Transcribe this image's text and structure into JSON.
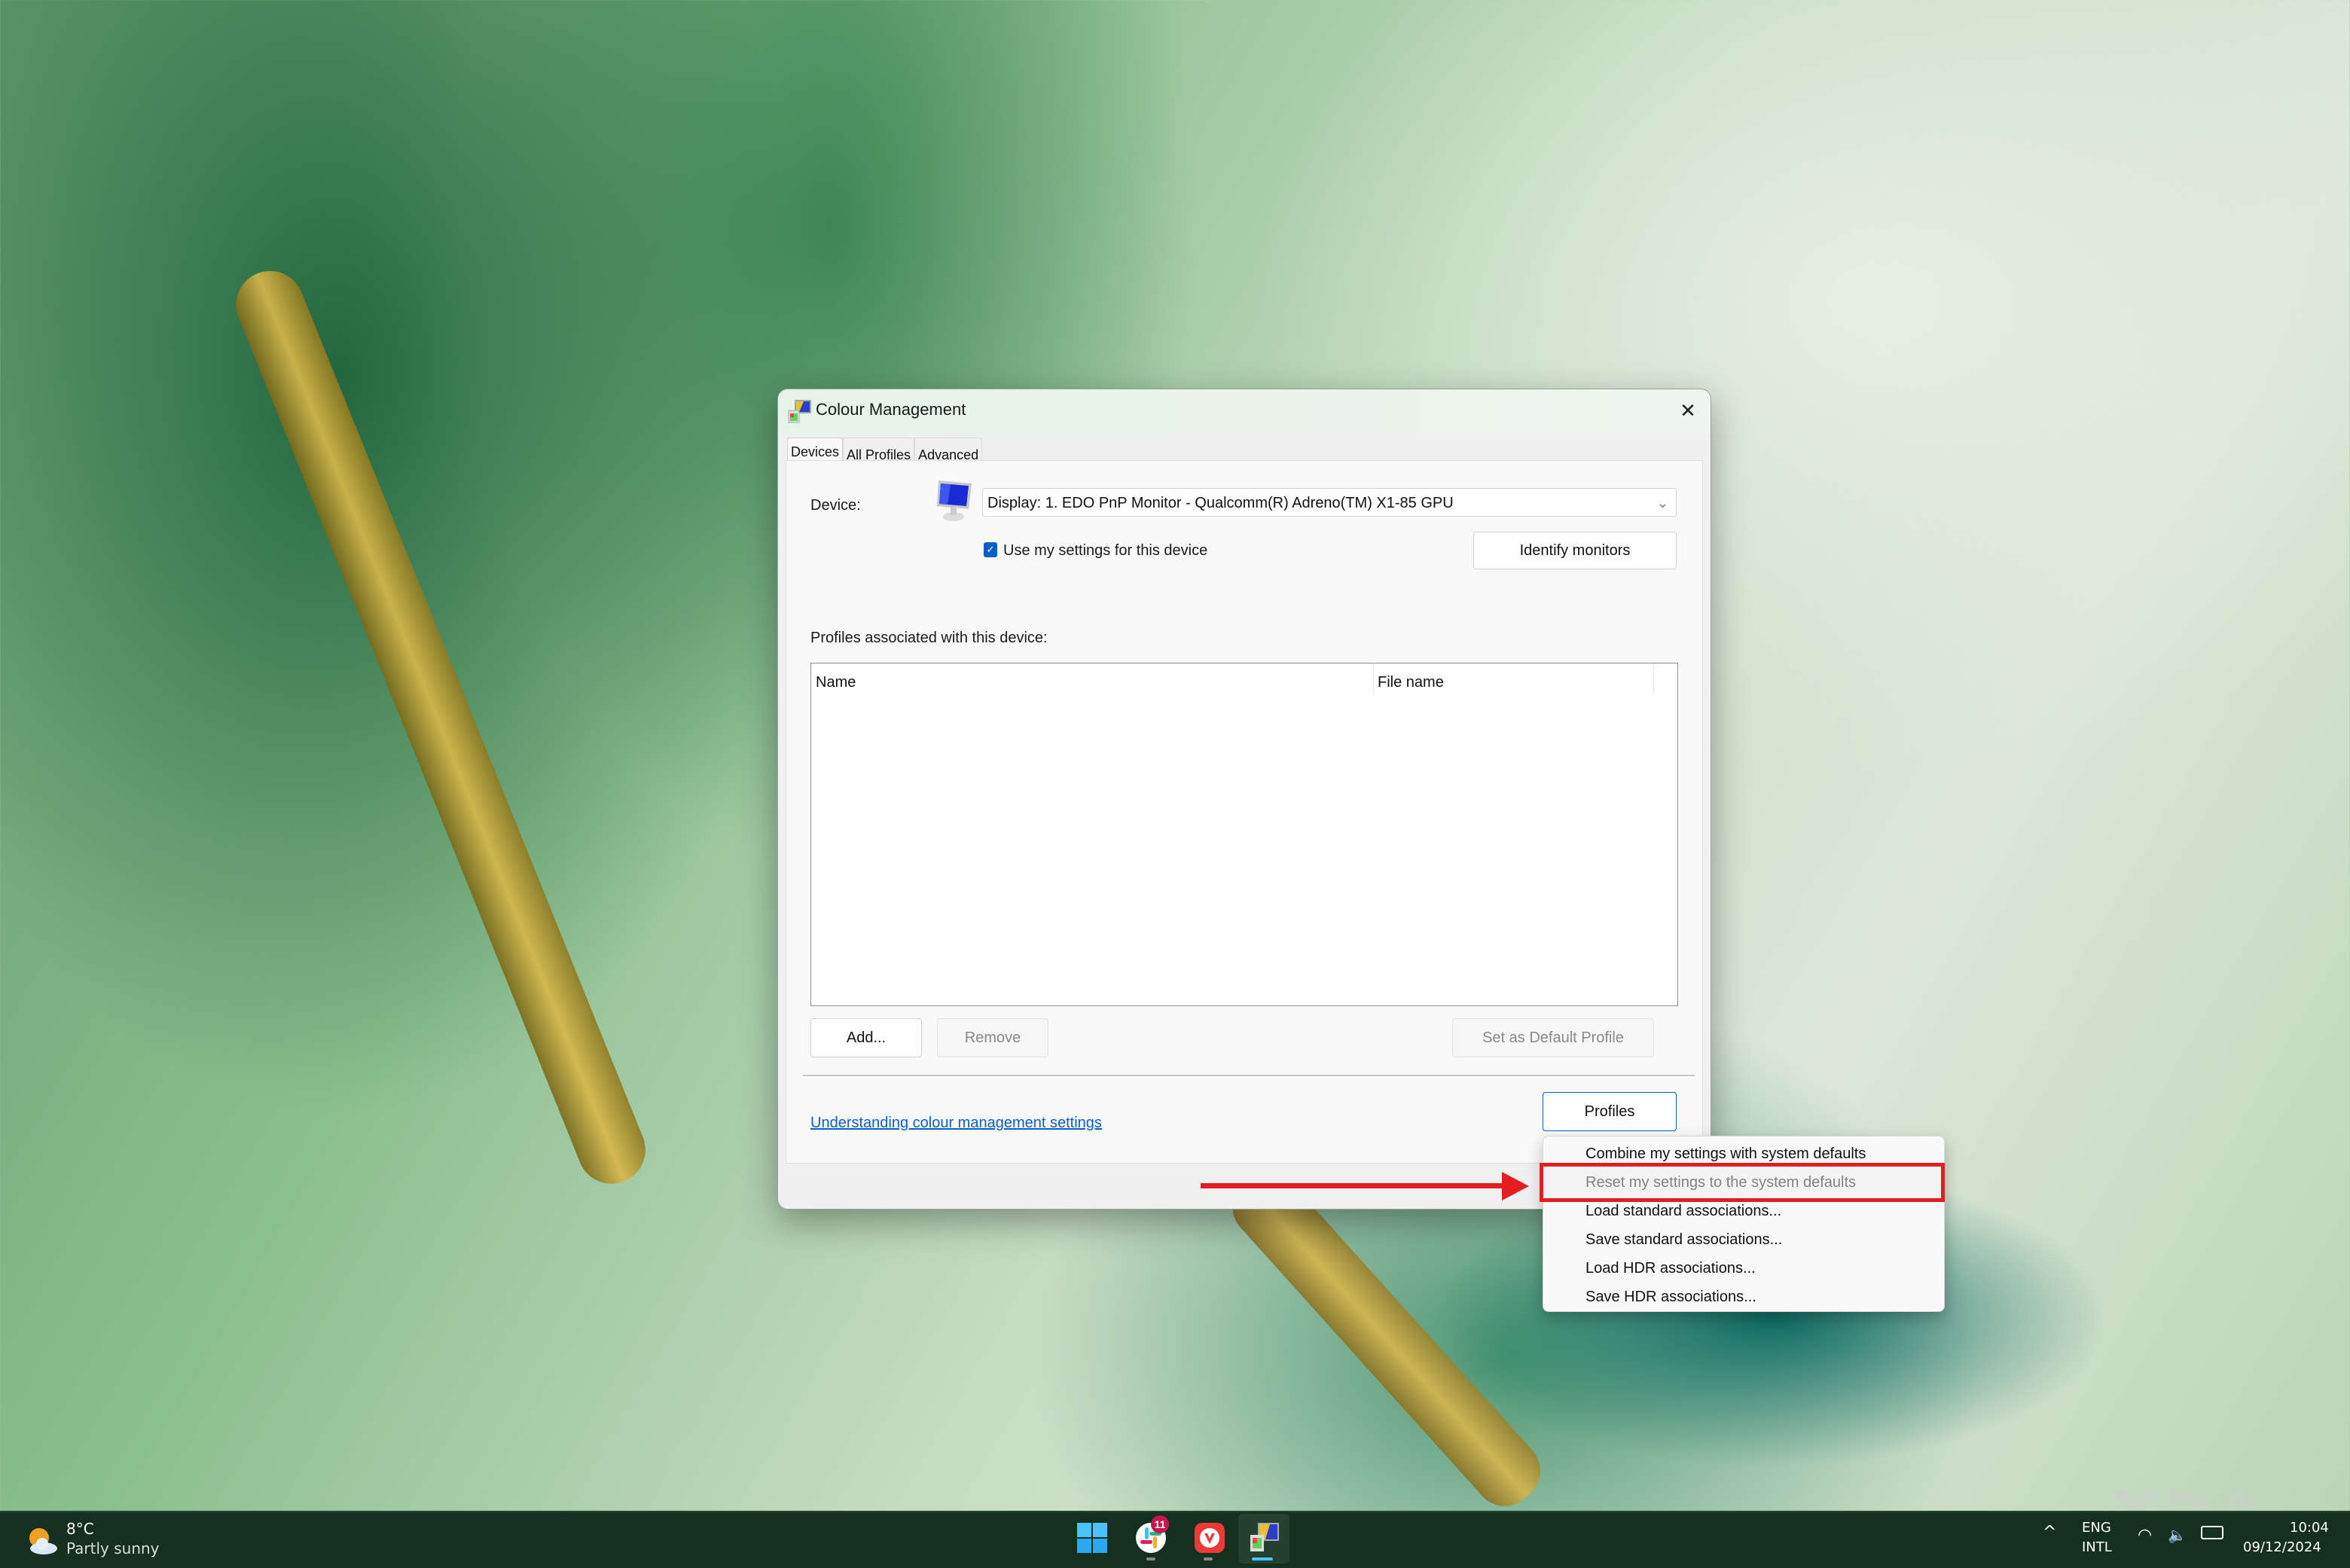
{
  "window": {
    "title": "Colour Management",
    "close_label": "✕",
    "tabs": [
      {
        "label": "Devices",
        "active": true
      },
      {
        "label": "All Profiles",
        "active": false
      },
      {
        "label": "Advanced",
        "active": false
      }
    ],
    "device_label": "Device:",
    "device_value": "Display: 1. EDO PnP Monitor - Qualcomm(R) Adreno(TM) X1-85 GPU",
    "use_my_settings_label": "Use my settings for this device",
    "use_my_settings_checked": true,
    "identify_monitors_label": "Identify monitors",
    "profiles_associated_label": "Profiles associated with this device:",
    "list_columns": [
      "Name",
      "File name"
    ],
    "list_rows": [],
    "add_label": "Add...",
    "remove_label": "Remove",
    "set_default_label": "Set as Default Profile",
    "help_link": "Understanding colour management settings",
    "profiles_button_label": "Profiles"
  },
  "profiles_menu": {
    "items": [
      "Combine my settings with system defaults",
      "Reset my settings to the system defaults",
      "Load standard associations...",
      "Save standard associations...",
      "Load HDR associations...",
      "Save HDR associations..."
    ],
    "highlighted_index": 1
  },
  "annotation": {
    "color": "#e41d23",
    "target": "Reset my settings to the system defaults"
  },
  "taskbar": {
    "weather_temp": "8°C",
    "weather_desc": "Partly sunny",
    "apps": [
      {
        "name": "start",
        "icon": "windows-logo-icon"
      },
      {
        "name": "slack",
        "icon": "slack-icon",
        "badge": "11"
      },
      {
        "name": "vivaldi",
        "icon": "vivaldi-icon"
      },
      {
        "name": "colour-management",
        "icon": "colour-management-icon",
        "active": true
      }
    ],
    "lang_top": "ENG",
    "lang_bottom": "INTL",
    "time": "10:04",
    "date": "09/12/2024"
  },
  "watermark": "XDA",
  "colors": {
    "accent": "#0a5fc4",
    "highlight": "#e41d23",
    "taskbar": "#14301f"
  }
}
